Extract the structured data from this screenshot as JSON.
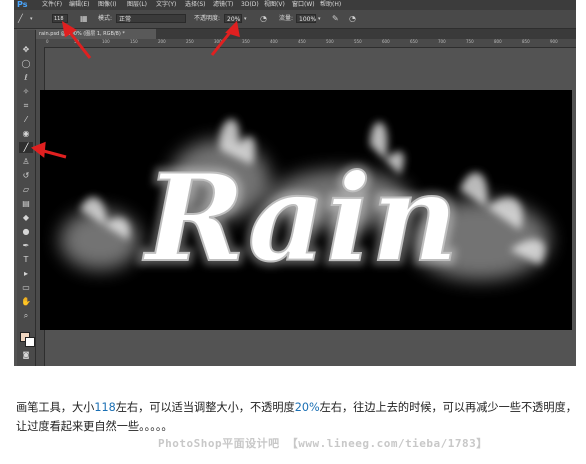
{
  "app": {
    "logo": "Ps"
  },
  "menu": [
    "文件(F)",
    "编辑(E)",
    "图像(I)",
    "图层(L)",
    "文字(Y)",
    "选择(S)",
    "滤镜(T)",
    "3D(D)",
    "视图(V)",
    "窗口(W)",
    "帮助(H)"
  ],
  "options": {
    "brush_size": "118",
    "mode_label": "模式:",
    "mode_value": "正常",
    "opacity_label": "不透明度:",
    "opacity_value": "20%",
    "flow_label": "流量:",
    "flow_value": "100%"
  },
  "document_tab": {
    "title": "rain.psd @ 100% (图层 1, RGB/8) *",
    "close": "×"
  },
  "ruler_ticks": [
    "0",
    "50",
    "100",
    "150",
    "200",
    "250",
    "300",
    "350",
    "400",
    "450",
    "500",
    "550",
    "600",
    "650",
    "700",
    "750",
    "800",
    "850",
    "900",
    "950"
  ],
  "canvas": {
    "art_text": "Rain"
  },
  "caption": {
    "part1": "画笔工具，大小",
    "size_num": "118",
    "part2": "左右，可以适当调整大小，不透明度",
    "opacity_num": "20%",
    "part3": "左右，往边上去的时候，可以再减少一些不透明度，让过度看起来更自然一些。。。。。"
  },
  "watermark": "PhotoShop平面设计吧 【www.lineeg.com/tieba/1783】",
  "colors": {
    "accent_arrow": "#e02020",
    "ps_logo": "#4aa7ff",
    "caption_number": "#1a6fb4"
  }
}
